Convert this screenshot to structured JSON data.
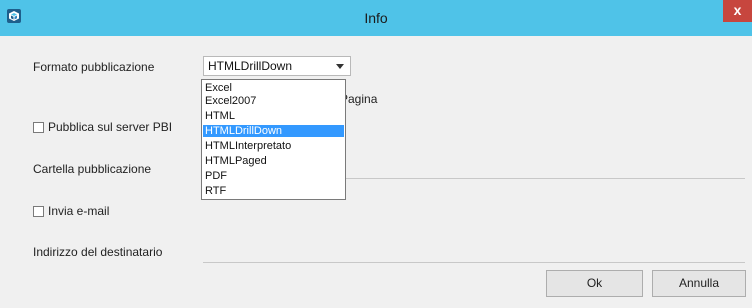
{
  "window": {
    "title": "Info",
    "close_glyph": "x",
    "app_icon": "cube-icon"
  },
  "form": {
    "format_label": "Formato pubblicazione",
    "format_selected": "HTMLDrillDown",
    "format_options": [
      "Excel",
      "Excel2007",
      "HTML",
      "HTMLDrillDown",
      "HTMLInterpretato",
      "HTMLPaged",
      "PDF",
      "RTF"
    ],
    "partial_label": "Pagina",
    "publish_pbi_label": "Pubblica sul server PBI",
    "publish_pbi_checked": false,
    "folder_label": "Cartella pubblicazione",
    "send_email_label": "Invia e-mail",
    "send_email_checked": false,
    "recipient_label": "Indirizzo del destinatario"
  },
  "buttons": {
    "ok_label": "Ok",
    "cancel_label": "Annulla"
  },
  "colors": {
    "titlebar": "#4fc3e8",
    "selection": "#3399ff",
    "close": "#c7463e"
  }
}
